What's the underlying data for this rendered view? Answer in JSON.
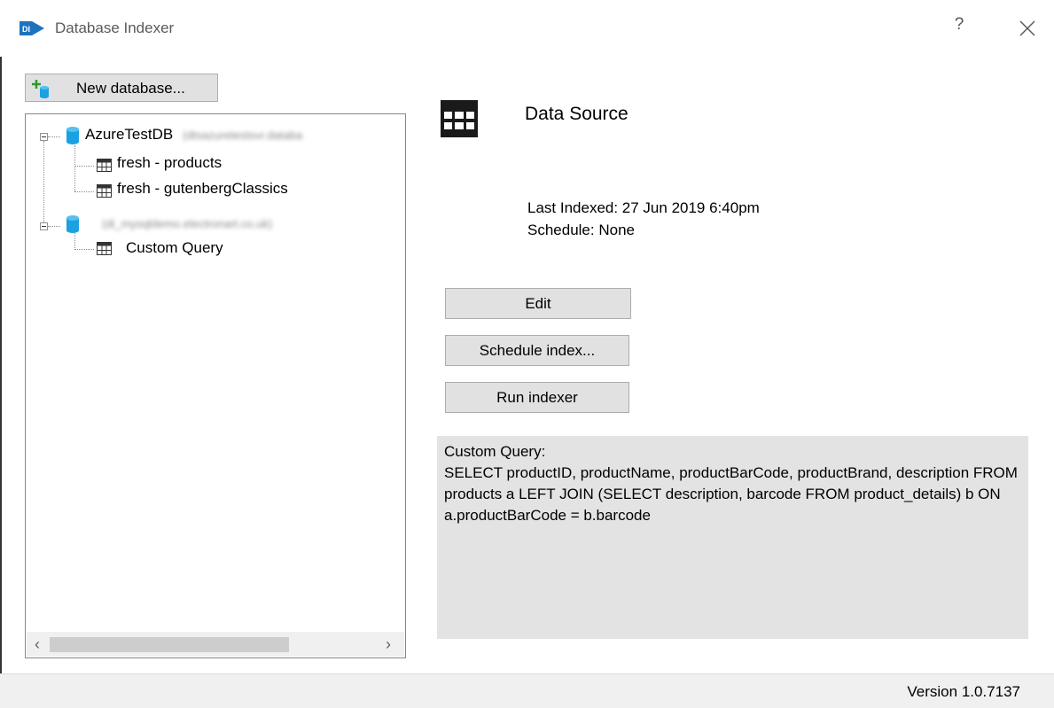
{
  "window": {
    "title": "Database Indexer",
    "help_label": "?",
    "close_icon": "close-icon",
    "app_icon_text": "DI"
  },
  "toolbar": {
    "new_database_label": "New database...",
    "new_database_icon": "add-database-icon"
  },
  "tree": {
    "nodes": [
      {
        "label": "AzureTestDB",
        "server": "(dtsazuretestsvr.databa",
        "children": [
          {
            "label": "fresh - products"
          },
          {
            "label": "fresh - gutenbergClassics"
          }
        ]
      },
      {
        "label": "",
        "server": "(di_mysqldemo.electronart.co.uk)",
        "children": [
          {
            "label": "Custom Query"
          }
        ]
      }
    ],
    "scroll_left_label": "‹",
    "scroll_right_label": "›"
  },
  "details": {
    "title": "Data Source",
    "last_indexed": "Last Indexed: 27 Jun 2019 6:40pm",
    "schedule": "Schedule: None",
    "edit_label": "Edit",
    "schedule_label": "Schedule index...",
    "run_label": "Run indexer",
    "query_heading": "Custom Query:",
    "query_text": "SELECT productID, productName, productBarCode, productBrand, description FROM products a LEFT JOIN (SELECT description, barcode FROM product_details) b ON a.productBarCode = b.barcode"
  },
  "status": {
    "version": "Version 1.0.7137"
  },
  "colors": {
    "accent": "#1e73be",
    "db_icon": "#1ba1e2",
    "button_bg": "#e1e1e1",
    "query_bg": "#e3e3e3"
  }
}
